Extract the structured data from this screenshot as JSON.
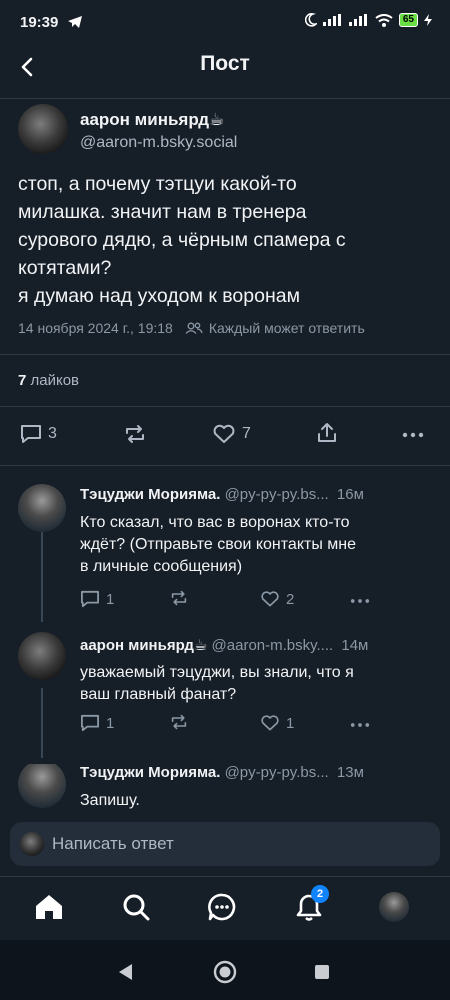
{
  "status": {
    "time": "19:39",
    "battery": "65"
  },
  "header": {
    "title": "Пост"
  },
  "post": {
    "author_name": "аарон миньярд☕",
    "author_handle": "@aaron-m.bsky.social",
    "text": "стоп, а почему тэтцуи какой-то\nмилашка. значит нам в тренера\nсурового дядю, а чёрным спамера с\nкотятами?\nя думаю над уходом к воронам",
    "date": "14 ноября 2024 г., 19:18",
    "reply_setting": "Каждый может ответить",
    "likes_count": "7",
    "likes_label": " лайков",
    "replies": "3",
    "likes": "7"
  },
  "replies": [
    {
      "name": "Тэцуджи Морияма.",
      "handle": "@py-py-py.bs...",
      "time": "16м",
      "text": "Кто сказал, что вас в воронах кто-то\nждёт? (Отправьте свои контакты мне\nв личные сообщения)",
      "replies": "1",
      "likes": "2"
    },
    {
      "name": "аарон миньярд☕",
      "handle": "@aaron-m.bsky....",
      "time": "14м",
      "text": "уважаемый тэцуджи, вы знали, что я\nваш главный фанат?",
      "replies": "1",
      "likes": "1"
    },
    {
      "name": "Тэцуджи Морияма.",
      "handle": "@py-py-py.bs...",
      "time": "13м",
      "text": "Запишу."
    }
  ],
  "compose": {
    "placeholder": "Написать ответ"
  },
  "tabbar": {
    "notifications_badge": "2"
  },
  "colors": {
    "background": "#161e27",
    "accent": "#1083fe",
    "divider": "#2e3a47"
  }
}
